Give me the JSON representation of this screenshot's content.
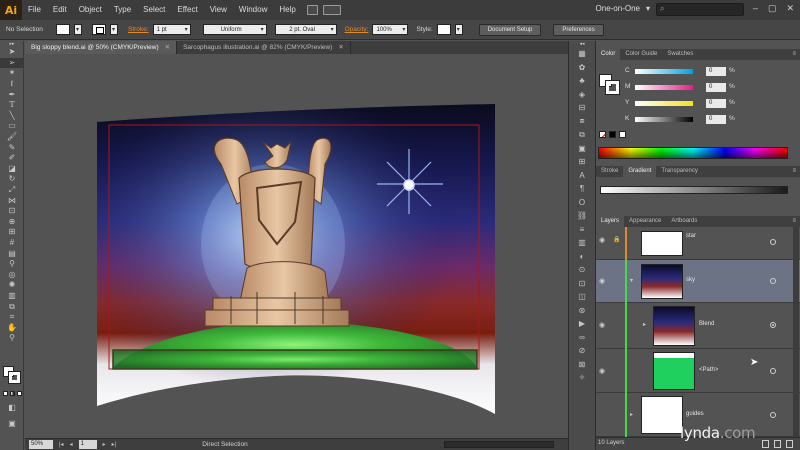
{
  "app": {
    "logo": "Ai"
  },
  "menu": [
    "File",
    "Edit",
    "Object",
    "Type",
    "Select",
    "Effect",
    "View",
    "Window",
    "Help"
  ],
  "workspace": "One-on-One",
  "window_controls": [
    "–",
    "▢",
    "✕"
  ],
  "control_bar": {
    "selection": "No Selection",
    "stroke_label": "Stroke:",
    "stroke_weight": "1 pt",
    "profile": "Uniform",
    "brush": "2 pt. Oval",
    "opacity_label": "Opacity:",
    "opacity_value": "100%",
    "style_label": "Style:",
    "document_setup": "Document Setup",
    "preferences": "Preferences"
  },
  "doc_tabs": [
    {
      "title": "Big sloppy blend.ai @ 50% (CMYK/Preview)",
      "close": "✕"
    },
    {
      "title": "Sarcophagus illustration.ai @ 82% (CMYK/Preview)",
      "close": "✕"
    }
  ],
  "status_bar": {
    "zoom": "50%",
    "page": "1",
    "tool": "Direct Selection",
    "nav_first": "|◂",
    "nav_prev": "◂",
    "nav_next": "▸",
    "nav_last": "▸|"
  },
  "color_panel": {
    "tabs": [
      "Color",
      "Color Guide",
      "Swatches"
    ],
    "channels": [
      {
        "label": "C",
        "value": "0",
        "unit": "%",
        "color": "#00a0e0"
      },
      {
        "label": "M",
        "value": "0",
        "unit": "%",
        "color": "#e0208a"
      },
      {
        "label": "Y",
        "value": "0",
        "unit": "%",
        "color": "#f4e020"
      },
      {
        "label": "K",
        "value": "0",
        "unit": "%",
        "color": "#000000"
      }
    ]
  },
  "stroke_panel": {
    "tabs": [
      "Stroke",
      "Gradient",
      "Transparency"
    ],
    "active": "Gradient"
  },
  "layers_panel": {
    "tabs": [
      "Layers",
      "Appearance",
      "Artboards"
    ],
    "layers": [
      {
        "name": "star",
        "color": "#e0892f"
      },
      {
        "name": "sky",
        "color": "#4bd64b"
      },
      {
        "name": "Blend",
        "color": "#4bd64b"
      },
      {
        "name": "<Path>",
        "color": "#4bd64b"
      },
      {
        "name": "guides",
        "color": "#4bd64b"
      }
    ],
    "count": "10 Layers"
  },
  "watermark": {
    "brand": "lynda",
    "dot": ".",
    "suffix": "com"
  }
}
